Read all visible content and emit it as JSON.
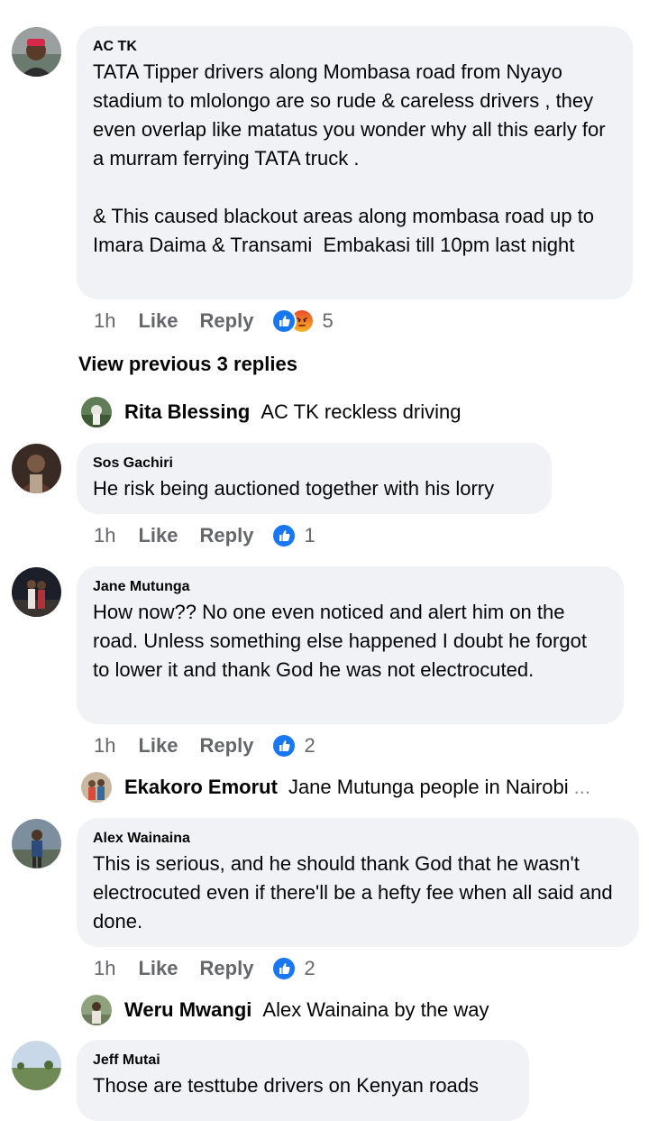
{
  "comments": [
    {
      "author": "AC TK",
      "text": "TATA Tipper drivers along Mombasa road from Nyayo stadium to mlolongo are so rude & careless drivers , they even overlap like matatus you wonder why all this early for a murram ferrying TATA truck .\n\n& This caused blackout areas along mombasa road up to Imara Daima & Transami  Embakasi till 10pm last night",
      "time": "1h",
      "like_label": "Like",
      "reply_label": "Reply",
      "reaction_count": "5",
      "reaction_icons": [
        "like-icon",
        "angry-icon"
      ]
    },
    {
      "author": "Sos Gachiri",
      "text": "He risk being auctioned together with his lorry",
      "time": "1h",
      "like_label": "Like",
      "reply_label": "Reply",
      "reaction_count": "1",
      "reaction_icons": [
        "like-icon"
      ]
    },
    {
      "author": "Jane Mutunga",
      "text": "How now?? No one even noticed and alert him on the road. Unless something else happened I doubt he forgot to lower it and thank God he was not electrocuted.",
      "time": "1h",
      "like_label": "Like",
      "reply_label": "Reply",
      "reaction_count": "2",
      "reaction_icons": [
        "like-icon"
      ]
    },
    {
      "author": "Alex Wainaina",
      "text": "This is serious, and he should thank God that he wasn't electrocuted even if there'll be a hefty fee when all said and done.",
      "time": "1h",
      "like_label": "Like",
      "reply_label": "Reply",
      "reaction_count": "2",
      "reaction_icons": [
        "like-icon"
      ]
    },
    {
      "author": "Jeff Mutai",
      "text": "Those are testtube drivers on Kenyan roads"
    }
  ],
  "view_previous": "View previous 3 replies",
  "replies": [
    {
      "name": "Rita Blessing",
      "text": "AC TK reckless driving"
    },
    {
      "name": "Ekakoro Emorut",
      "text": "Jane Mutunga people in Nairobi",
      "more": "..."
    },
    {
      "name": "Weru Mwangi",
      "text": "Alex Wainaina by the way"
    }
  ],
  "colors": {
    "bubble": "#f0f2f5",
    "secondary_text": "#65676b",
    "like_blue": "#1877f2"
  }
}
